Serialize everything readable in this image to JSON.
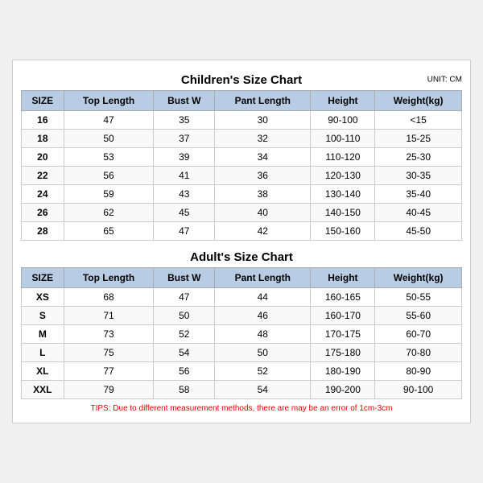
{
  "children_title": "Children's Size Chart",
  "adults_title": "Adult's Size Chart",
  "unit_label": "UNIT: CM",
  "columns": [
    "SIZE",
    "Top Length",
    "Bust W",
    "Pant Length",
    "Height",
    "Weight(kg)"
  ],
  "children_rows": [
    [
      "16",
      "47",
      "35",
      "30",
      "90-100",
      "<15"
    ],
    [
      "18",
      "50",
      "37",
      "32",
      "100-110",
      "15-25"
    ],
    [
      "20",
      "53",
      "39",
      "34",
      "110-120",
      "25-30"
    ],
    [
      "22",
      "56",
      "41",
      "36",
      "120-130",
      "30-35"
    ],
    [
      "24",
      "59",
      "43",
      "38",
      "130-140",
      "35-40"
    ],
    [
      "26",
      "62",
      "45",
      "40",
      "140-150",
      "40-45"
    ],
    [
      "28",
      "65",
      "47",
      "42",
      "150-160",
      "45-50"
    ]
  ],
  "adult_rows": [
    [
      "XS",
      "68",
      "47",
      "44",
      "160-165",
      "50-55"
    ],
    [
      "S",
      "71",
      "50",
      "46",
      "160-170",
      "55-60"
    ],
    [
      "M",
      "73",
      "52",
      "48",
      "170-175",
      "60-70"
    ],
    [
      "L",
      "75",
      "54",
      "50",
      "175-180",
      "70-80"
    ],
    [
      "XL",
      "77",
      "56",
      "52",
      "180-190",
      "80-90"
    ],
    [
      "XXL",
      "79",
      "58",
      "54",
      "190-200",
      "90-100"
    ]
  ],
  "tips": "TIPS: Due to different measurement methods, there are may be an error of 1cm-3cm"
}
